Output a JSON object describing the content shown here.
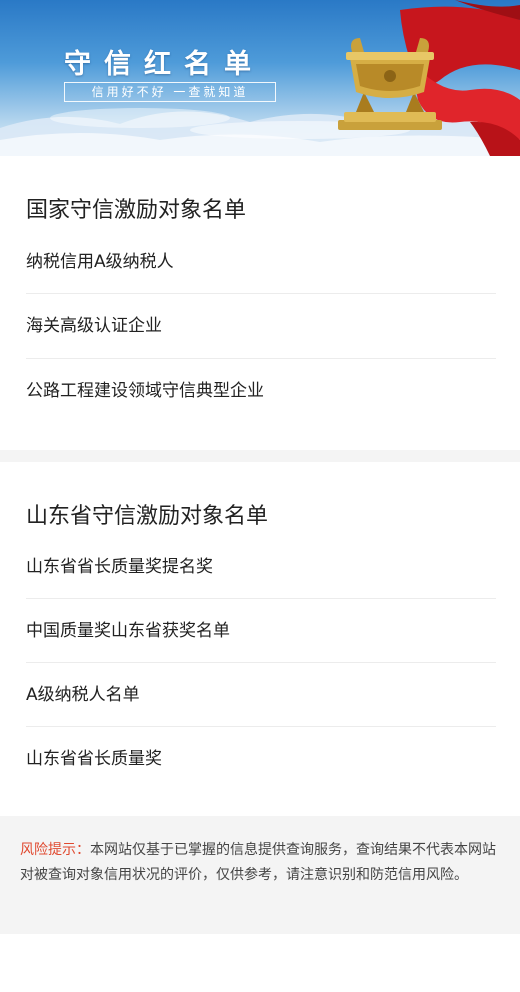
{
  "banner": {
    "title": "守信红名单",
    "slogan": "信用好不好  一查就知道"
  },
  "national": {
    "title": "国家守信激励对象名单",
    "items": [
      {
        "label": "纳税信用A级纳税人"
      },
      {
        "label": "海关高级认证企业"
      },
      {
        "label": "公路工程建设领域守信典型企业"
      }
    ]
  },
  "shandong": {
    "title": "山东省守信激励对象名单",
    "items": [
      {
        "label": "山东省省长质量奖提名奖"
      },
      {
        "label": "中国质量奖山东省获奖名单"
      },
      {
        "label": "A级纳税人名单"
      },
      {
        "label": "山东省省长质量奖"
      }
    ]
  },
  "notice": {
    "label": "风险提示：",
    "text": "本网站仅基于已掌握的信息提供查询服务，查询结果不代表本网站对被查询对象信用状况的评价，仅供参考，请注意识别和防范信用风险。"
  },
  "colors": {
    "accent": "#e0492f",
    "banner_blue": "#2a79c6",
    "gap": "#f4f4f4"
  }
}
